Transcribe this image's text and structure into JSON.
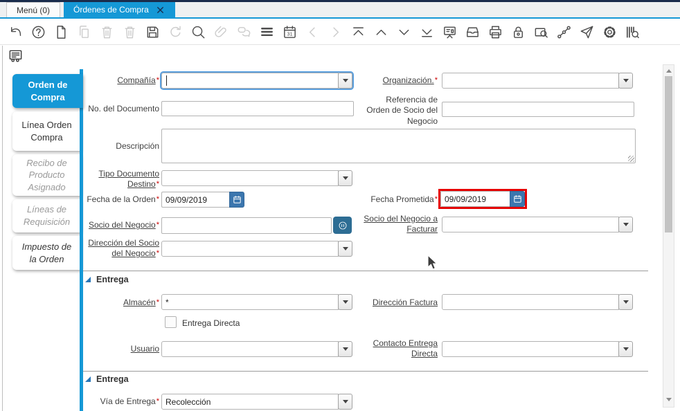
{
  "colors": {
    "accent_blue": "#1598d6",
    "top_strip_navy": "#1a2c4c",
    "highlight_red": "#e60000",
    "required_red": "#cc0000",
    "date_button_blue": "#3b76ae",
    "bp_button_blue": "#2d6d94"
  },
  "header": {
    "tabs": [
      {
        "name": "menu-tab",
        "label": "Menú (0)",
        "active": false
      },
      {
        "name": "ordenes-de-compra-tab",
        "label": "Órdenes de Compra",
        "active": true
      }
    ]
  },
  "toolbar": {
    "icons": [
      {
        "name": "undo-icon",
        "enabled": true
      },
      {
        "name": "help-icon",
        "enabled": true
      },
      {
        "name": "new-record-icon",
        "enabled": true
      },
      {
        "name": "copy-record-icon",
        "enabled": false
      },
      {
        "name": "delete-record-icon",
        "enabled": false
      },
      {
        "name": "delete-selection-icon",
        "enabled": false
      },
      {
        "name": "save-icon",
        "enabled": true
      },
      {
        "name": "refresh-icon",
        "enabled": false
      },
      {
        "name": "find-icon",
        "enabled": true
      },
      {
        "name": "attachment-icon",
        "enabled": false
      },
      {
        "name": "chat-icon",
        "enabled": false
      },
      {
        "name": "grid-toggle-icon",
        "enabled": true
      },
      {
        "name": "calendar-icon",
        "enabled": true
      },
      {
        "name": "parent-record-icon",
        "enabled": false
      },
      {
        "name": "detail-record-icon",
        "enabled": false
      },
      {
        "name": "first-record-icon",
        "enabled": true
      },
      {
        "name": "previous-record-icon",
        "enabled": true
      },
      {
        "name": "next-record-icon",
        "enabled": true
      },
      {
        "name": "last-record-icon",
        "enabled": true
      },
      {
        "name": "report-icon",
        "enabled": true
      },
      {
        "name": "archive-icon",
        "enabled": true
      },
      {
        "name": "print-icon",
        "enabled": true
      },
      {
        "name": "private-record-lock-icon",
        "enabled": true
      },
      {
        "name": "zoom-across-icon",
        "enabled": true
      },
      {
        "name": "workflow-icon",
        "enabled": true
      },
      {
        "name": "send-request-icon",
        "enabled": true
      },
      {
        "name": "preferences-icon",
        "enabled": true
      },
      {
        "name": "product-info-icon",
        "enabled": true
      }
    ]
  },
  "sidebar": {
    "tabs": [
      {
        "name": "tab-orden-de-compra",
        "label": "Orden de Compra",
        "state": "active"
      },
      {
        "name": "tab-linea-orden-compra",
        "label": "Línea Orden Compra",
        "state": "normal"
      },
      {
        "name": "tab-recibo-de-producto-asignado",
        "label": "Recibo de Producto Asignado",
        "state": "muted"
      },
      {
        "name": "tab-lineas-de-requisicion",
        "label": "Líneas de Requisición",
        "state": "muted"
      },
      {
        "name": "tab-impuesto-de-la-orden",
        "label": "Impuesto de la Orden",
        "state": "italic"
      }
    ]
  },
  "form": {
    "required_marker": "*",
    "compania": {
      "label": "Compañía",
      "value": ""
    },
    "organizacion": {
      "label": "Organización.",
      "value": ""
    },
    "no_documento": {
      "label": "No. del Documento",
      "value": ""
    },
    "referencia": {
      "label": "Referencia de Orden de Socio del Negocio",
      "value": ""
    },
    "descripcion": {
      "label": "Descripción",
      "value": ""
    },
    "tipo_documento": {
      "label": "Tipo Documento Destino",
      "value": ""
    },
    "fecha_orden": {
      "label": "Fecha de la Orden",
      "value": "09/09/2019"
    },
    "fecha_prometida": {
      "label": "Fecha Prometida",
      "value": "09/09/2019",
      "highlighted": true
    },
    "socio_negocio": {
      "label": "Socio del Negocio",
      "value": ""
    },
    "socio_facturar": {
      "label": "Socio del Negocio a Facturar",
      "value": ""
    },
    "direccion_socio": {
      "label": "Dirección del Socio del Negocio",
      "value": ""
    },
    "seccion_entrega_1": {
      "title": "Entrega"
    },
    "almacen": {
      "label": "Almacén",
      "value": "*"
    },
    "direccion_factura": {
      "label": "Dirección Factura",
      "value": ""
    },
    "entrega_directa": {
      "label": "Entrega Directa",
      "checked": false
    },
    "usuario": {
      "label": "Usuario",
      "value": ""
    },
    "contacto_entrega": {
      "label": "Contacto Entrega Directa",
      "value": ""
    },
    "seccion_entrega_2": {
      "title": "Entrega"
    },
    "via_entrega": {
      "label": "Vía de Entrega",
      "value": "Recolección"
    }
  }
}
